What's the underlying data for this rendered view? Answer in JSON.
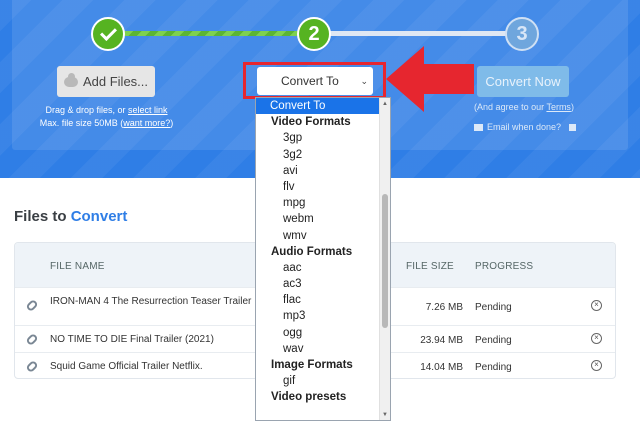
{
  "steps": {
    "step2_label": "2",
    "step3_label": "3"
  },
  "upload": {
    "add_files_label": "Add Files...",
    "drag_prefix": "Drag & drop files, or ",
    "select_link": "select link",
    "max_size_prefix": "Max. file size 50MB (",
    "want_more": "want more?",
    "max_size_suffix": ")"
  },
  "convert_select": {
    "value": "Convert To",
    "chevron": "⌄"
  },
  "convert_now": {
    "label": "Convert Now",
    "agree_prefix": "(And agree to our ",
    "terms": "Terms",
    "agree_suffix": ")",
    "email_label": "Email when done?"
  },
  "files": {
    "title_prefix": "Files to ",
    "title_accent": "Convert",
    "columns": [
      "FILE NAME",
      "FILE SIZE",
      "PROGRESS"
    ],
    "rows": [
      {
        "name": "IRON-MAN 4 The Resurrection Teaser Trailer",
        "size": "7.26 MB",
        "progress": "Pending"
      },
      {
        "name": "NO TIME TO DIE Final Trailer (2021)",
        "size": "23.94 MB",
        "progress": "Pending"
      },
      {
        "name": "Squid Game Official Trailer Netflix.",
        "size": "14.04 MB",
        "progress": "Pending"
      }
    ]
  },
  "dropdown": {
    "selected": "Convert To",
    "groups": [
      {
        "label": "Video Formats",
        "options": [
          "3gp",
          "3g2",
          "avi",
          "flv",
          "mpg",
          "webm",
          "wmv"
        ]
      },
      {
        "label": "Audio Formats",
        "options": [
          "aac",
          "ac3",
          "flac",
          "mp3",
          "ogg",
          "wav"
        ]
      },
      {
        "label": "Image Formats",
        "options": [
          "gif"
        ]
      },
      {
        "label": "Video presets",
        "options": []
      }
    ]
  },
  "colors": {
    "header_blue": "#2f7ee6",
    "step_green": "#56b321",
    "callout_red": "#e6262f",
    "selected_blue": "#1a73e8"
  }
}
